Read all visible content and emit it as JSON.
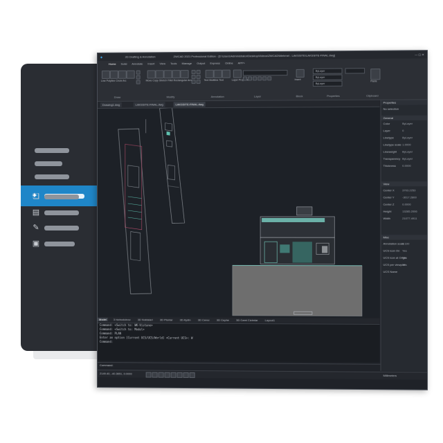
{
  "nav": {
    "items": [
      {
        "icon": "pin-icon",
        "active": true
      },
      {
        "icon": "",
        "active": false
      },
      {
        "icon": "",
        "active": false
      },
      {
        "icon": "",
        "active": false
      },
      {
        "icon": "people-icon",
        "active": false
      },
      {
        "icon": "pages-icon",
        "active": false
      },
      {
        "icon": "wrench-icon",
        "active": false
      },
      {
        "icon": "dashboard-icon",
        "active": false
      }
    ],
    "colors": {
      "panel": "#2a2d33",
      "active": "#1f86c8"
    }
  },
  "window": {
    "title": "ZWCAD 2021 Professional Edition - [D:\\Users\\Administrator\\Desktop\\Videos\\ZWCAD\\Mehmet - LAKSSITE\\LAKSSITE-FINAL.dwg]",
    "quick_access": "2D Drafting & Annotation",
    "ribbon_tabs": [
      "Home",
      "Solid",
      "Annotate",
      "Insert",
      "View",
      "Tools",
      "Manage",
      "Output",
      "Express",
      "Online",
      "APP+"
    ],
    "ribbon_panels": [
      "Draw",
      "Modify",
      "Annotation",
      "Layer",
      "Block",
      "Properties",
      "Clipboard"
    ],
    "draw_tools": [
      "Line",
      "Polyline",
      "Circle",
      "Arc"
    ],
    "modify_tools": [
      "Move",
      "Copy",
      "Stretch",
      "Fillet",
      "Rectangular Array"
    ],
    "annotation_tools": [
      "Text",
      "Multiline Text",
      "Dimension"
    ],
    "layer_tools": [
      "Layer Properties"
    ],
    "block_tools": [
      "Insert"
    ],
    "clipboard_tools": [
      "Paste"
    ],
    "property_combos": [
      "ByLayer",
      "ByLayer",
      "ByLayer"
    ],
    "doc_tabs": [
      "Drawing1.dwg",
      "LAKSSITE-FINAL.dwg",
      "LAKSSITE-FINAL.dwg"
    ],
    "layout_tabs": [
      "Model",
      "3 hiohodoinov",
      "3D Noktalari",
      "3D Planlar",
      "3D Aydin",
      "3D Cerez",
      "3D Cephe",
      "3D Cami Cizimlar",
      "Layout1"
    ],
    "command_lines": [
      "Command: <Switch to: WK-Vistane>",
      "Command: <Switch to: Model>",
      "Command: PLAN",
      "Enter an option [Current UCS/UCS/World] <Current UCS>: W",
      "Command:"
    ],
    "command_prompt": "Command:",
    "status_coords": "2149.40, -40.3651, 0.0000",
    "status_right": "Millimeters"
  },
  "properties": {
    "title": "Properties",
    "selection": "No selection",
    "sections": [
      {
        "name": "General",
        "rows": [
          {
            "label": "Color",
            "value": "ByLayer"
          },
          {
            "label": "Layer",
            "value": "0"
          },
          {
            "label": "Linetype",
            "value": "ByLayer"
          },
          {
            "label": "Linetype scale",
            "value": "1.0000"
          },
          {
            "label": "Lineweight",
            "value": "ByLayer"
          },
          {
            "label": "Transparency",
            "value": "ByLayer"
          },
          {
            "label": "Thickness",
            "value": "0.0000"
          }
        ]
      },
      {
        "name": "View",
        "rows": [
          {
            "label": "Center X",
            "value": "3703.2253"
          },
          {
            "label": "Center Y",
            "value": "-3017.2800"
          },
          {
            "label": "Center Z",
            "value": "0.0000"
          },
          {
            "label": "Height",
            "value": "13285.2006"
          },
          {
            "label": "Width",
            "value": "21077.4911"
          }
        ]
      },
      {
        "name": "Misc",
        "rows": [
          {
            "label": "Annotation scale",
            "value": "1:100"
          },
          {
            "label": "UCS icon On",
            "value": "Yes"
          },
          {
            "label": "UCS icon at Origin",
            "value": "Yes"
          },
          {
            "label": "UCS per viewport",
            "value": "Yes"
          },
          {
            "label": "UCS Name",
            "value": ""
          }
        ]
      }
    ]
  },
  "colors": {
    "accent": "#1f86c8",
    "canvas": "#1d2127",
    "drawing_line": "#7ad2c4",
    "ground": "#7a7a7a"
  }
}
